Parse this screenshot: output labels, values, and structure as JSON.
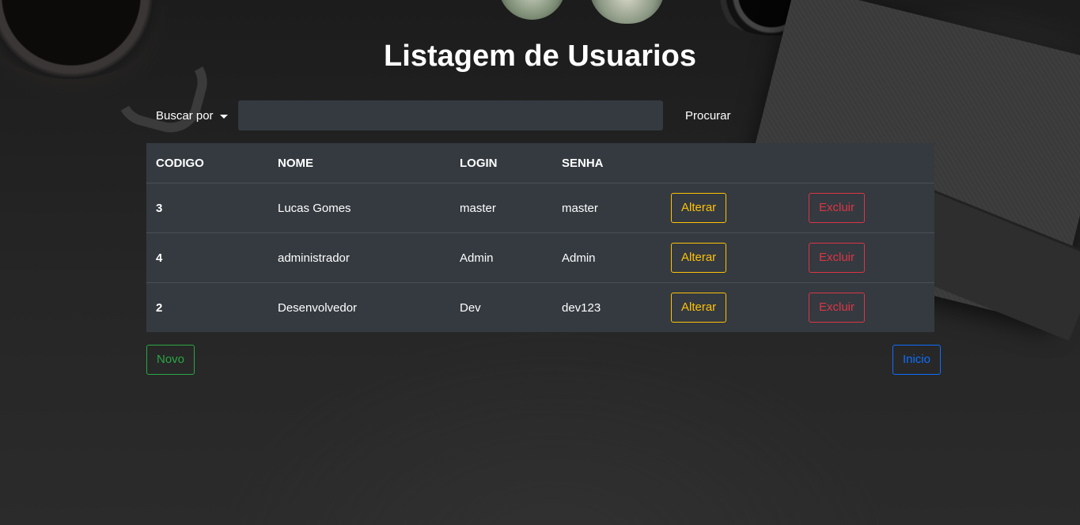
{
  "page": {
    "title": "Listagem de Usuarios"
  },
  "search": {
    "dropdown_label": "Buscar por",
    "input_value": "",
    "button_label": "Procurar"
  },
  "table": {
    "headers": [
      "CODIGO",
      "NOME",
      "LOGIN",
      "SENHA"
    ],
    "rows": [
      {
        "codigo": "3",
        "nome": "Lucas Gomes",
        "login": "master",
        "senha": "master",
        "alterar": "Alterar",
        "excluir": "Excluir"
      },
      {
        "codigo": "4",
        "nome": "administrador",
        "login": "Admin",
        "senha": "Admin",
        "alterar": "Alterar",
        "excluir": "Excluir"
      },
      {
        "codigo": "2",
        "nome": "Desenvolvedor",
        "login": "Dev",
        "senha": "dev123",
        "alterar": "Alterar",
        "excluir": "Excluir"
      }
    ]
  },
  "actions": {
    "novo_label": "Novo",
    "inicio_label": "Inicio"
  },
  "colors": {
    "warning": "#ffc107",
    "danger": "#dc3545",
    "success": "#28a745",
    "primary": "#0d6efd",
    "table_bg": "#343a40"
  }
}
